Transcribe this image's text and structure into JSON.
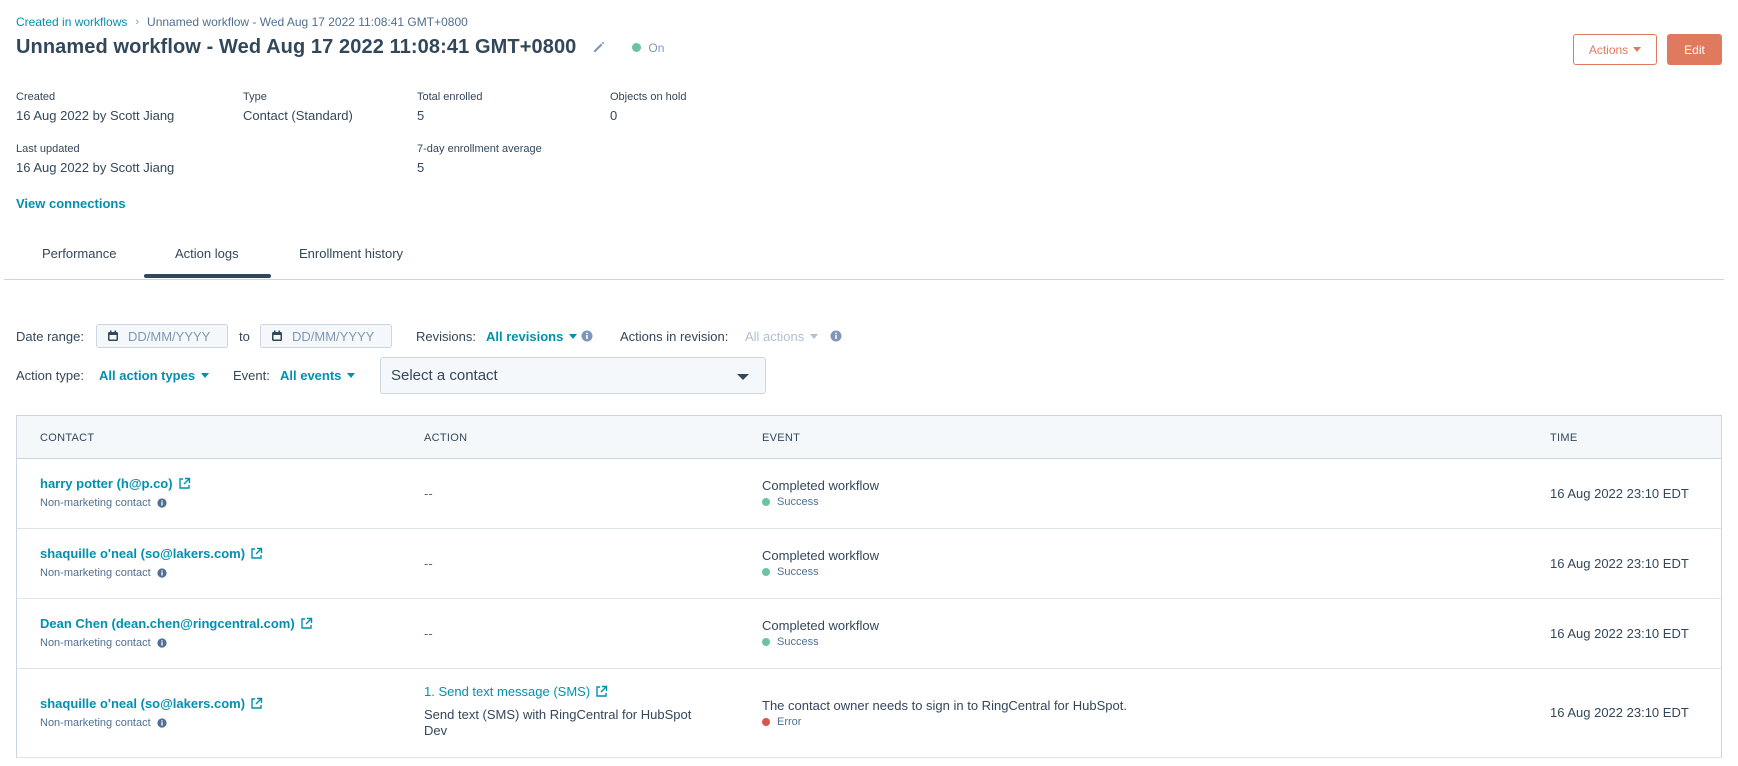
{
  "breadcrumb": {
    "parent": "Created in workflows",
    "separator": "›",
    "current": "Unnamed workflow - Wed Aug 17 2022 11:08:41 GMT+0800"
  },
  "header": {
    "title": "Unnamed workflow - Wed Aug 17 2022 11:08:41 GMT+0800",
    "status": "On",
    "status_color": "#6cc3a0",
    "actions_label": "Actions",
    "edit_label": "Edit",
    "accent_color": "#e07a5f"
  },
  "details": {
    "created_label": "Created",
    "created_value": "16 Aug 2022 by Scott Jiang",
    "type_label": "Type",
    "type_value": "Contact (Standard)",
    "total_enrolled_label": "Total enrolled",
    "total_enrolled_value": "5",
    "objects_on_hold_label": "Objects on hold",
    "objects_on_hold_value": "0",
    "last_updated_label": "Last updated",
    "last_updated_value": "16 Aug 2022 by Scott Jiang",
    "enrollment_avg_label": "7-day enrollment average",
    "enrollment_avg_value": "5",
    "view_connections": "View connections"
  },
  "tabs": {
    "performance": "Performance",
    "action_logs": "Action logs",
    "enrollment_history": "Enrollment history",
    "active": "Action logs"
  },
  "filters": {
    "date_range_label": "Date range:",
    "date_placeholder": "DD/MM/YYYY",
    "to_label": "to",
    "revisions_label": "Revisions:",
    "revisions_value": "All revisions",
    "actions_in_revision_label": "Actions in revision:",
    "actions_in_revision_value": "All actions",
    "action_type_label": "Action type:",
    "action_type_value": "All action types",
    "event_label": "Event:",
    "event_value": "All events",
    "contact_select_placeholder": "Select a contact"
  },
  "table": {
    "columns": {
      "contact": "CONTACT",
      "action": "ACTION",
      "event": "EVENT",
      "time": "TIME"
    },
    "rows": [
      {
        "contact": "harry potter (h@p.co)",
        "contact_sub": "Non-marketing contact",
        "action": "--",
        "event": "Completed workflow",
        "event_status": "Success",
        "time": "16 Aug 2022 23:10 EDT"
      },
      {
        "contact": "shaquille o'neal (so@lakers.com)",
        "contact_sub": "Non-marketing contact",
        "action": "--",
        "event": "Completed workflow",
        "event_status": "Success",
        "time": "16 Aug 2022 23:10 EDT"
      },
      {
        "contact": "Dean Chen (dean.chen@ringcentral.com)",
        "contact_sub": "Non-marketing contact",
        "action": "--",
        "event": "Completed workflow",
        "event_status": "Success",
        "time": "16 Aug 2022 23:10 EDT"
      },
      {
        "contact": "shaquille o'neal (so@lakers.com)",
        "contact_sub": "Non-marketing contact",
        "action_link": "1. Send text message (SMS)",
        "action_desc": "Send text (SMS) with RingCentral for HubSpot Dev",
        "event": "The contact owner needs to sign in to RingCentral for HubSpot.",
        "event_status": "Error",
        "time": "16 Aug 2022 23:10 EDT"
      }
    ],
    "success_color": "#6cc3a0",
    "error_color": "#d9534f"
  },
  "icons": {
    "pencil": "pencil-icon",
    "external_link": "external-link-icon",
    "info": "info-icon",
    "calendar": "calendar-icon",
    "chevron": "chevron-right-icon",
    "caret": "caret-down-icon"
  }
}
